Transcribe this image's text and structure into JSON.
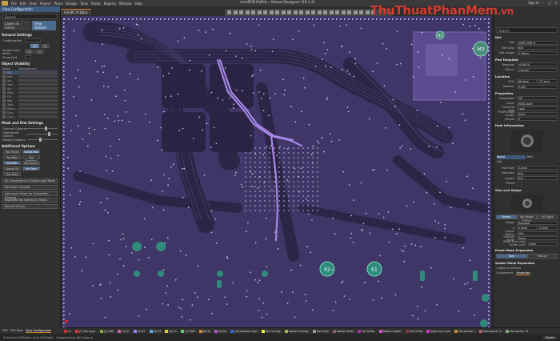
{
  "app": {
    "window_title": "miniPCB.PrjPcb - Altium Designer (19.1.2)",
    "sign_in": "Sign In"
  },
  "watermark": {
    "brand": "ThuThuatPhanMem",
    "tld": ".vn"
  },
  "menu": [
    "File",
    "Edit",
    "View",
    "Project",
    "Place",
    "Design",
    "Tools",
    "Route",
    "Reports",
    "Window",
    "Help"
  ],
  "document_tab": "miniPC.PcbDoc",
  "left_panel": {
    "title": "View Configuration",
    "search_placeholder": "Search",
    "tabs": [
      "Layers & Colors",
      "View Options"
    ],
    "general_settings": {
      "header": "General Settings",
      "configuration_label": "Configuration",
      "single_layer_mode_label": "Single Layer Mode",
      "show_grid_label": "Show Grid"
    },
    "object_visibility": {
      "header": "Object Visibility",
      "col_name": "Name",
      "col_transparency": "Transparency",
      "rows": [
        "ALL...",
        "Pad...",
        "Via...",
        "Trac...",
        "Arc...",
        "Poly...",
        "Fill...",
        "Reg...",
        "Text...",
        "Room...",
        "Dim...",
        "Coor..."
      ]
    },
    "mask_dim": {
      "header": "Mask and Dim Settings",
      "dimmed": "Dimmed Objects",
      "highlighted": "Highlighted Objects",
      "masked": "Masked Objects"
    },
    "additional": {
      "header": "Additional Options",
      "grid_a": [
        "Test Points",
        "Status Info",
        "Pad Nets",
        "Pad Numbers",
        "Via Nets",
        "Net Names",
        "Special Str",
        "Via Span",
        "Port Nets"
      ],
      "buttons": [
        "All Connections in Single Layer Mode",
        "Net Color Override",
        "Use Layer Colors for Connection Drawing",
        "Repeated Net Names on Tracks",
        "Special Strings"
      ]
    },
    "footer_tabs": [
      "PCB",
      "PCB Filter",
      "View Configuration"
    ]
  },
  "right_panel": {
    "search_placeholder": "Search",
    "net_section": {
      "header": "Net",
      "net_label": "Net",
      "net_value": "USB3_DDR_N",
      "net_class_label": "Net Class",
      "net_class_value": "N/A",
      "net_length_label": "Net Length",
      "net_length_value": "1.78mm"
    },
    "pad_template": {
      "header": "Pad Template",
      "template_label": "Template",
      "template_value": "c100h70",
      "library_label": "Library",
      "library_value": "<Local>"
    },
    "location": {
      "header": "Location",
      "x_label": "(X/Y)",
      "x_value": "86.4mm",
      "y_value": "72.1mm",
      "rotation_label": "Rotation",
      "rotation_value": "0.000"
    },
    "properties": {
      "header": "Properties",
      "designator_label": "Designator",
      "designator_value": "M3",
      "layer_label": "Layer",
      "layer_value": "Multi-Layer",
      "electrical_type_label": "Electrical Type",
      "electrical_type_value": "Load",
      "pin_package_label": "Pin/Package Length",
      "pin_package_value": "0mm",
      "jumper_label": "Jumper",
      "jumper_value": "0"
    },
    "hole_info": {
      "header": "Hole information",
      "radios": [
        "Round",
        "Rect",
        "Slot"
      ],
      "hole_size_label": "Hole Size",
      "hole_size_value": "2.2mm",
      "tolerance_label": "Tolerance",
      "tolerance_value": "N/A",
      "length_label": "Length",
      "length_value": "N/A",
      "plated_label": "Plated"
    },
    "size_shape": {
      "header": "Size and Shape",
      "tabs": [
        "Simple",
        "Top-Middle-Bottom",
        "Full Stack"
      ],
      "shape_label": "Shape",
      "shape_value": "Rounded",
      "x_label": "X",
      "x_value": "1.2mm",
      "y_value": "1.2mm",
      "corner_label": "Corner Radius",
      "corner_value": "50%",
      "thermal_label": "Thermal Relief",
      "thermal_value": "Direct",
      "offset_label": "Offset From Hole Center (X/Y)",
      "offset_value": "0mm"
    },
    "paste_mask": {
      "header": "Paste Mask Expansion",
      "toggle": [
        "Rule",
        "Manual"
      ]
    },
    "solder_mask": {
      "header": "Solder Mask Expansion"
    },
    "footer": {
      "selection_count": "1 object is selected",
      "tab_a": "Components",
      "tab_b": "Properties"
    }
  },
  "canvas_labels": {
    "m1": "M1",
    "m3": "M3",
    "k1": "K1",
    "k2": "K2"
  },
  "layers": [
    {
      "name": "LS",
      "color": "#c33"
    },
    {
      "name": "[1] Top Layer",
      "color": "#d33"
    },
    {
      "name": "[2] GND",
      "color": "#8a4"
    },
    {
      "name": "[3] S1",
      "color": "#c6a"
    },
    {
      "name": "[4] S2",
      "color": "#88f"
    },
    {
      "name": "[5] S3",
      "color": "#5ae"
    },
    {
      "name": "[6] S4",
      "color": "#dc3"
    },
    {
      "name": "[7] PWR",
      "color": "#6c6"
    },
    {
      "name": "[8] S5",
      "color": "#c84"
    },
    {
      "name": "[9] S6",
      "color": "#a5c"
    },
    {
      "name": "[10] Bottom Layer",
      "color": "#36d"
    },
    {
      "name": "Top Overlay",
      "color": "#ee4"
    },
    {
      "name": "Bottom Overlay",
      "color": "#aa5"
    },
    {
      "name": "Top Paste",
      "color": "#999"
    },
    {
      "name": "Bottom Paste",
      "color": "#866"
    },
    {
      "name": "Top Solder",
      "color": "#a3a"
    },
    {
      "name": "Bottom Solder",
      "color": "#c5c"
    },
    {
      "name": "Drill Guide",
      "color": "#833"
    },
    {
      "name": "Keep-Out Layer",
      "color": "#c3c"
    },
    {
      "name": "Mechanical 1",
      "color": "#c83"
    },
    {
      "name": "Mechanical 13",
      "color": "#a66"
    },
    {
      "name": "Mechanical 15",
      "color": "#7a7"
    }
  ],
  "status": {
    "coords": "X:60.4mm Y:83.8mm  Grid: 0.025mm",
    "hotspot": "(Hotspot Snap (All Layers))",
    "panels": "Panels"
  },
  "colors": {
    "board": "#433a6a",
    "trace": "#2a233f",
    "selected": "#9a7bd8",
    "pad": "#3aa08e"
  }
}
